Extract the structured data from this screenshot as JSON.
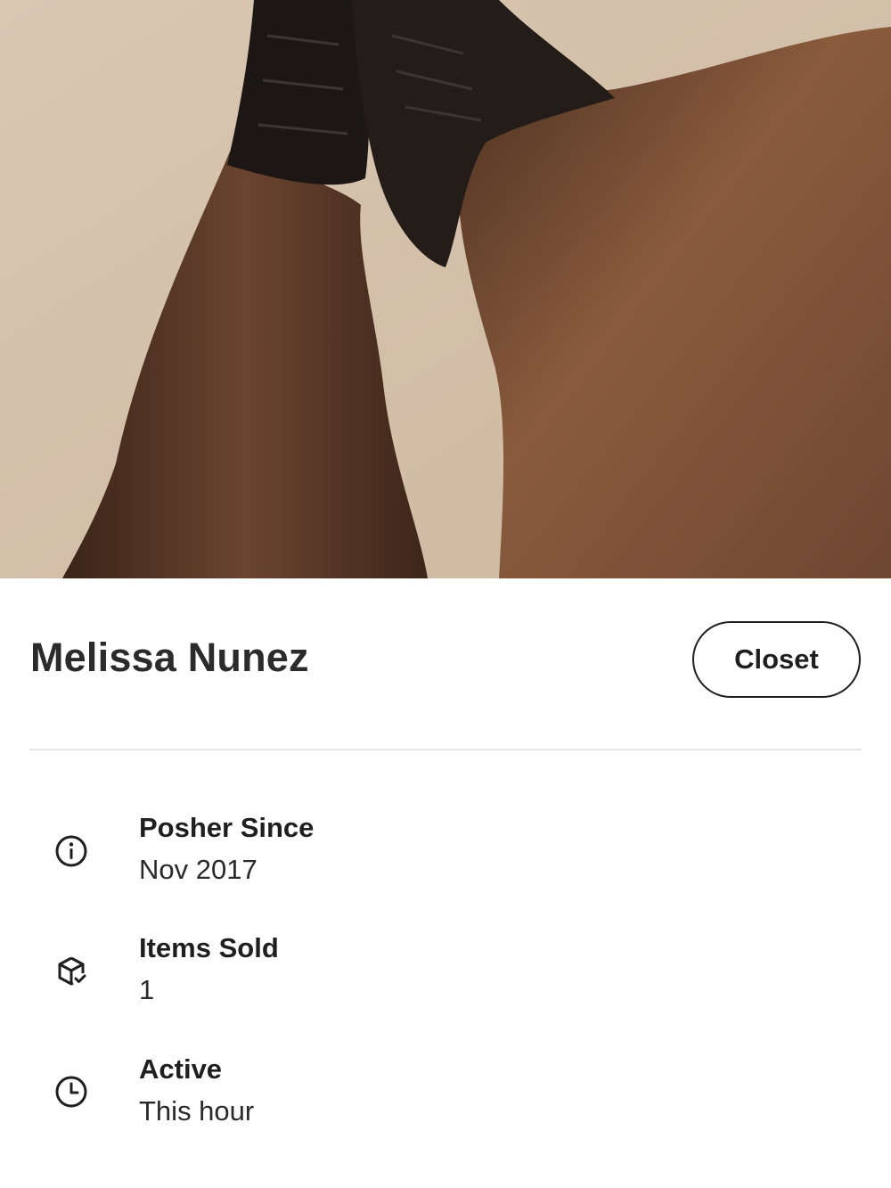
{
  "profile": {
    "name": "Melissa Nunez",
    "closet_button_label": "Closet"
  },
  "info": {
    "items": [
      {
        "icon": "info-circle-icon",
        "label": "Posher Since",
        "value": "Nov 2017"
      },
      {
        "icon": "box-check-icon",
        "label": "Items Sold",
        "value": "1"
      },
      {
        "icon": "clock-icon",
        "label": "Active",
        "value": "This hour"
      }
    ]
  },
  "colors": {
    "text_primary": "#222222",
    "divider": "#e6e6e6",
    "button_border": "#1f1f1f",
    "background": "#ffffff"
  }
}
